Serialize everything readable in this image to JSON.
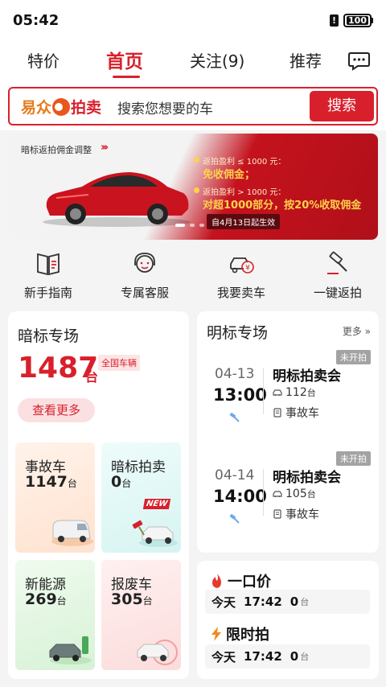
{
  "status_bar": {
    "time": "05:42",
    "battery": "100"
  },
  "tabs": [
    {
      "label": "特价"
    },
    {
      "label": "首页"
    },
    {
      "label": "关注(9)"
    },
    {
      "label": "推荐"
    }
  ],
  "search": {
    "brand_part1": "易众",
    "brand_part2": "拍卖",
    "placeholder": "搜索您想要的车",
    "button": "搜索"
  },
  "banner": {
    "tag": "暗标返拍佣金调整",
    "line1": "返拍盈利 ≤ 1000 元：",
    "highlight1": "免收佣金；",
    "line2": "返拍盈利 > 1000 元：",
    "highlight2": "对超1000部分，按20%收取佣金",
    "date": "自4月13日起生效"
  },
  "quick_nav": [
    {
      "label": "新手指南",
      "icon": "guide-book-icon"
    },
    {
      "label": "专属客服",
      "icon": "customer-service-icon"
    },
    {
      "label": "我要卖车",
      "icon": "sell-car-icon"
    },
    {
      "label": "一键返拍",
      "icon": "auction-hammer-icon"
    }
  ],
  "hidden_bid": {
    "title": "暗标专场",
    "count": "1487",
    "unit": "台",
    "badge": "全国车辆",
    "see_more": "查看更多",
    "tiles": [
      {
        "name": "事故车",
        "count": "1147",
        "unit": "台"
      },
      {
        "name": "暗标拍卖",
        "count": "0",
        "unit": "台",
        "tag": "NEW"
      },
      {
        "name": "新能源",
        "count": "269",
        "unit": "台"
      },
      {
        "name": "报废车",
        "count": "305",
        "unit": "台"
      }
    ]
  },
  "open_bid": {
    "title": "明标专场",
    "more": "更多",
    "sessions": [
      {
        "status": "未开拍",
        "date": "04-13",
        "time": "13:00",
        "title": "明标拍卖会",
        "cars": "112",
        "unit": "台",
        "category": "事故车"
      },
      {
        "status": "未开拍",
        "date": "04-14",
        "time": "14:00",
        "title": "明标拍卖会",
        "cars": "105",
        "unit": "台",
        "category": "事故车"
      }
    ]
  },
  "deals": [
    {
      "title": "一口价",
      "icon": "fire-icon",
      "day": "今天",
      "time": "17:42",
      "count": "0",
      "unit": "台"
    },
    {
      "title": "限时拍",
      "icon": "lightning-icon",
      "day": "今天",
      "time": "17:42",
      "count": "0",
      "unit": "台"
    }
  ],
  "colors": {
    "accent": "#d8202c",
    "brand_orange": "#e77a1c"
  }
}
